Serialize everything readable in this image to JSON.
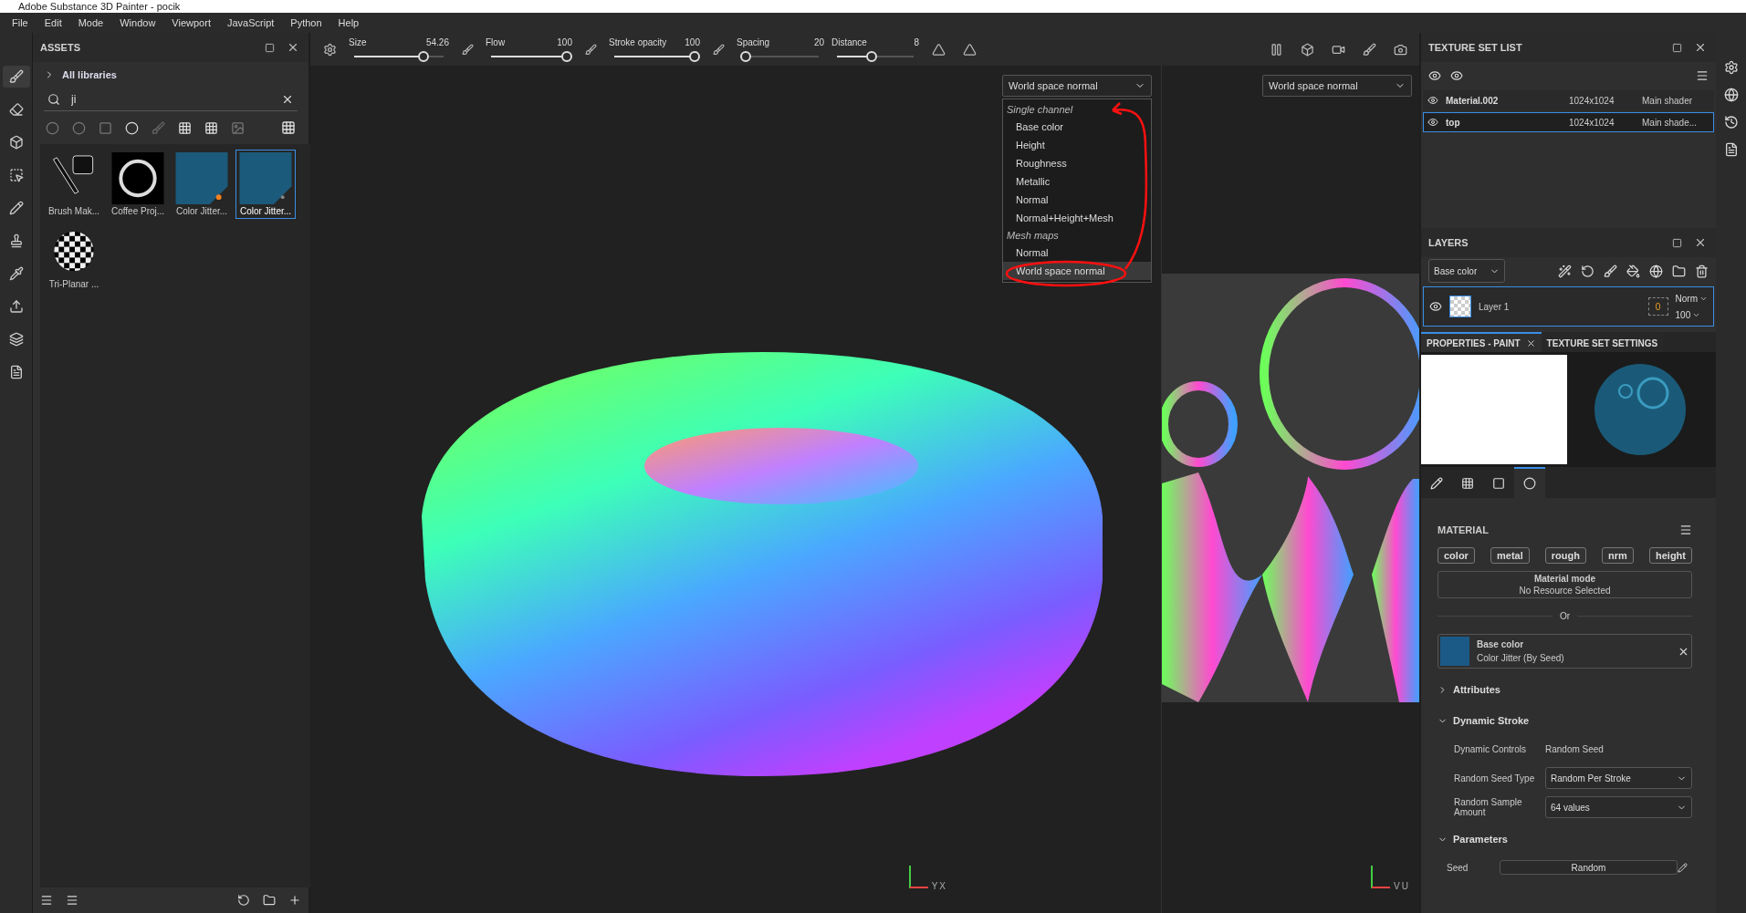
{
  "window": {
    "title": "Adobe Substance 3D Painter - pocik"
  },
  "menu": [
    "File",
    "Edit",
    "Mode",
    "Window",
    "Viewport",
    "JavaScript",
    "Python",
    "Help"
  ],
  "assets": {
    "title": "ASSETS",
    "library": "All libraries",
    "search": {
      "value": "ji"
    },
    "items": [
      {
        "label": "Brush Mak...",
        "kind": "brush",
        "selected": false
      },
      {
        "label": "Coffee Proj...",
        "kind": "projection",
        "selected": false
      },
      {
        "label": "Color Jitter...",
        "kind": "generator",
        "selected": false
      },
      {
        "label": "Color Jitter...",
        "kind": "filter",
        "selected": true
      },
      {
        "label": "Tri-Planar ...",
        "kind": "triplanar",
        "selected": false
      }
    ]
  },
  "brush_toolbar": {
    "params": [
      {
        "label": "Size",
        "value": "54.26",
        "level": 0.78
      },
      {
        "label": "Flow",
        "value": "100",
        "level": 1
      },
      {
        "label": "Stroke opacity",
        "value": "100",
        "level": 1
      },
      {
        "label": "Spacing",
        "value": "20",
        "level": 0.05
      },
      {
        "label": "Distance",
        "value": "8",
        "level": 0.45
      }
    ]
  },
  "viewport_3d": {
    "channel": "World space normal",
    "axes": [
      "Y",
      "X"
    ],
    "menu": [
      {
        "heading": "Single channel",
        "items": [
          {
            "label": "Base color",
            "selected": false
          },
          {
            "label": "Height",
            "selected": false
          },
          {
            "label": "Roughness",
            "selected": false
          },
          {
            "label": "Metallic",
            "selected": false
          },
          {
            "label": "Normal",
            "selected": false
          },
          {
            "label": "Normal+Height+Mesh",
            "selected": false
          }
        ]
      },
      {
        "heading": "Mesh maps",
        "items": [
          {
            "label": "Normal",
            "selected": false
          },
          {
            "label": "World space normal",
            "selected": true
          }
        ]
      }
    ]
  },
  "viewport_2d": {
    "channel": "World space normal",
    "axes": [
      "V",
      "U"
    ]
  },
  "texture_set_list": {
    "title": "TEXTURE SET LIST",
    "rows": [
      {
        "name": "Material.002",
        "size": "1024x1024",
        "shader": "Main shader",
        "selected": false
      },
      {
        "name": "top",
        "size": "1024x1024",
        "shader": "Main shade...",
        "selected": true
      }
    ]
  },
  "layers": {
    "title": "LAYERS",
    "channel": "Base color",
    "items": [
      {
        "name": "Layer 1",
        "mask_count": "0",
        "blend": "Norm",
        "opacity": "100",
        "selected": true
      }
    ]
  },
  "properties": {
    "tabs": [
      {
        "label": "PROPERTIES - PAINT",
        "selected": true
      },
      {
        "label": "TEXTURE SET SETTINGS",
        "selected": false
      }
    ],
    "icon_tabs": [
      {
        "kind": "stroke",
        "selected": false
      },
      {
        "kind": "alpha",
        "selected": false
      },
      {
        "kind": "stencil",
        "selected": false
      },
      {
        "kind": "material",
        "selected": true
      }
    ],
    "material": {
      "title": "MATERIAL",
      "channels": [
        "color",
        "metal",
        "rough",
        "nrm",
        "height"
      ],
      "mode_title": "Material mode",
      "mode_value": "No Resource Selected",
      "separator": "Or",
      "base_color": {
        "title": "Base color",
        "resource": "Color Jitter (By Seed)",
        "color": "#1b5a86"
      }
    },
    "sections": [
      {
        "title": "Attributes",
        "expanded": false
      },
      {
        "title": "Dynamic Stroke",
        "expanded": true,
        "rows": [
          {
            "label": "Dynamic Controls",
            "value": "Random Seed",
            "kind": "text"
          },
          {
            "label": "Random Seed Type",
            "value": "Random Per Stroke",
            "kind": "select"
          },
          {
            "label": "Random Sample Amount",
            "value": "64 values",
            "kind": "select"
          }
        ]
      },
      {
        "title": "Parameters",
        "expanded": true,
        "rows": [
          {
            "label": "Seed",
            "value": "Random",
            "kind": "button"
          }
        ]
      }
    ]
  }
}
